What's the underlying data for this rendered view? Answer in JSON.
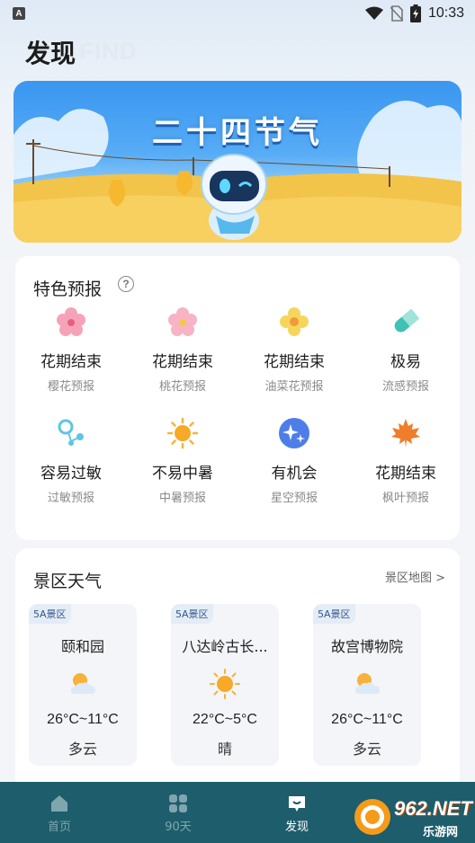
{
  "status_bar": {
    "time": "10:33",
    "app_glyph": "A"
  },
  "header": {
    "title": "发现",
    "subtitle": "FIND"
  },
  "banner": {
    "title": "二十四节气"
  },
  "features": {
    "title": "特色预报",
    "help": "?",
    "items": [
      {
        "status": "花期结束",
        "label": "樱花预报",
        "icon": "cherry-blossom-icon"
      },
      {
        "status": "花期结束",
        "label": "桃花预报",
        "icon": "peach-blossom-icon"
      },
      {
        "status": "花期结束",
        "label": "油菜花预报",
        "icon": "rapeseed-flower-icon"
      },
      {
        "status": "极易",
        "label": "流感预报",
        "icon": "pill-icon"
      },
      {
        "status": "容易过敏",
        "label": "过敏预报",
        "icon": "pollen-icon"
      },
      {
        "status": "不易中暑",
        "label": "中暑预报",
        "icon": "sun-icon"
      },
      {
        "status": "有机会",
        "label": "星空预报",
        "icon": "stars-icon"
      },
      {
        "status": "花期结束",
        "label": "枫叶预报",
        "icon": "maple-leaf-icon"
      }
    ]
  },
  "scenic": {
    "title": "景区天气",
    "map_link": "景区地图 >",
    "items": [
      {
        "badge": "5A景区",
        "name": "颐和园",
        "temp": "26°C~11°C",
        "cond": "多云",
        "icon": "partly-cloudy-icon"
      },
      {
        "badge": "5A景区",
        "name": "八达岭古长...",
        "temp": "22°C~5°C",
        "cond": "晴",
        "icon": "sunny-icon"
      },
      {
        "badge": "5A景区",
        "name": "故宫博物院",
        "temp": "26°C~11°C",
        "cond": "多云",
        "icon": "partly-cloudy-icon"
      }
    ]
  },
  "nav": {
    "items": [
      {
        "label": "首页",
        "icon": "home-icon"
      },
      {
        "label": "90天",
        "icon": "grid-icon"
      },
      {
        "label": "发现",
        "icon": "discover-icon"
      },
      {
        "label": "",
        "icon": ""
      }
    ],
    "active_index": 2
  },
  "watermark": {
    "text": "962.NET",
    "sub": "乐游网"
  }
}
